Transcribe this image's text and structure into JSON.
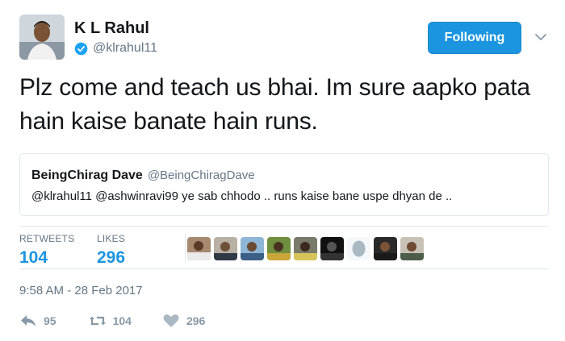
{
  "author": {
    "name": "K L Rahul",
    "handle": "@klrahul11",
    "verified_icon": "verified-badge-icon"
  },
  "follow_label": "Following",
  "tweet_text": "Plz come and teach us bhai. Im sure aapko pata hain kaise banate hain runs.",
  "quoted_tweet": {
    "name": "BeingChirag Dave",
    "handle": "@BeingChiragDave",
    "text": "@klrahul11 @ashwinravi99 ye sab chhodo .. runs kaise bane uspe dhyan de .."
  },
  "stats": {
    "retweets_label": "RETWEETS",
    "retweets_value": "104",
    "likes_label": "LIKES",
    "likes_value": "296"
  },
  "timestamp": "9:58 AM - 28 Feb 2017",
  "actions": {
    "reply_count": "95",
    "retweet_count": "104",
    "like_count": "296"
  },
  "colors": {
    "accent": "#1b95e0",
    "muted": "#657786",
    "border": "#e1e8ed"
  }
}
